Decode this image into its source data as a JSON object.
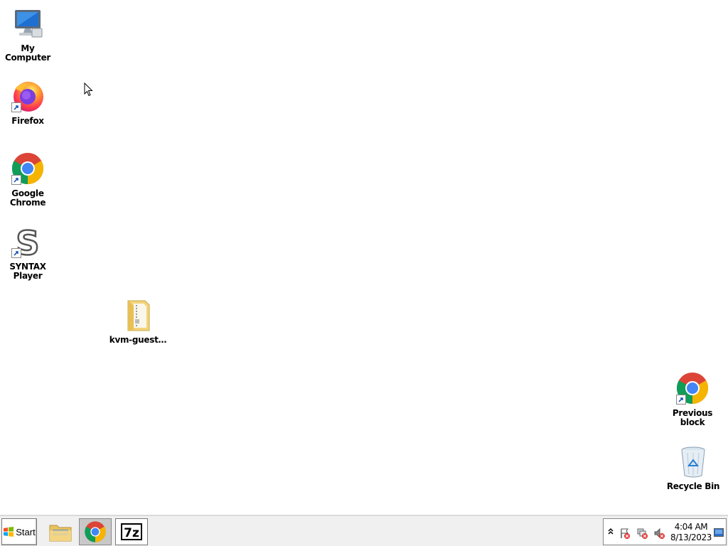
{
  "desktop_icons": {
    "my_computer": {
      "label": "My Computer",
      "icon": "computer-icon"
    },
    "firefox": {
      "label": "Firefox",
      "icon": "firefox-icon"
    },
    "chrome": {
      "label": "Google Chrome",
      "icon": "chrome-icon"
    },
    "syntax": {
      "label": "SYNTAX Player",
      "icon": "syntax-icon"
    },
    "kvm": {
      "label": "kvm-guest…",
      "icon": "folder-icon"
    },
    "previous_block": {
      "label": "Previous block",
      "icon": "chrome-icon"
    },
    "recycle_bin": {
      "label": "Recycle Bin",
      "icon": "recycle-bin-icon"
    }
  },
  "taskbar": {
    "start_label": "Start",
    "pinned": [
      {
        "name": "file-explorer",
        "icon": "folder-icon"
      },
      {
        "name": "chrome",
        "icon": "chrome-icon",
        "active": true
      },
      {
        "name": "7zip",
        "icon": "7zip-icon",
        "text": "7z"
      }
    ],
    "tray": {
      "time": "4:04 AM",
      "date": "8/13/2023",
      "chevron": "^"
    }
  },
  "colors": {
    "taskbar_bg": "#f0f0f0",
    "chrome_red": "#db4437",
    "chrome_green": "#0f9d58",
    "chrome_yellow": "#f4b400",
    "chrome_blue": "#4285f4"
  }
}
